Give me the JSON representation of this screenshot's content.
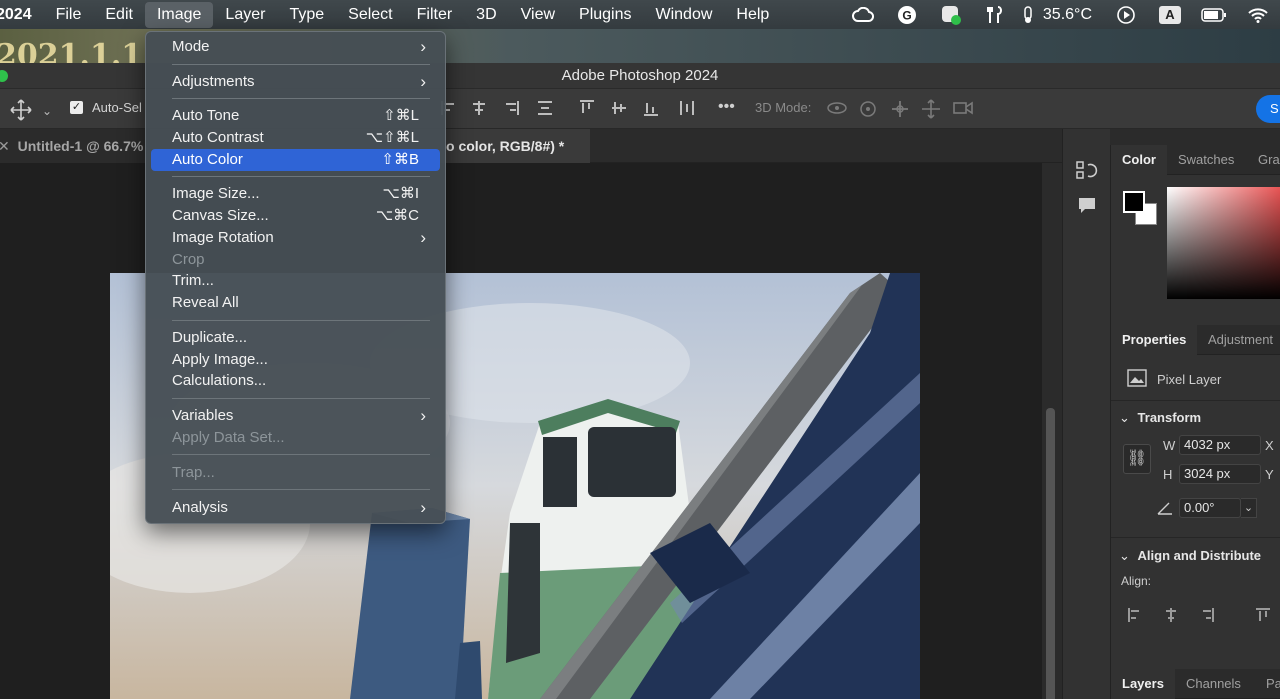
{
  "menubar": {
    "app_label": "2024",
    "items": [
      "File",
      "Edit",
      "Image",
      "Layer",
      "Type",
      "Select",
      "Filter",
      "3D",
      "View",
      "Plugins",
      "Window",
      "Help"
    ],
    "active": "Image",
    "temperature": "35.6°C",
    "input_source": "A"
  },
  "desktop": {
    "text": "2021.1.1"
  },
  "window": {
    "title": "Adobe Photoshop 2024"
  },
  "options_bar": {
    "auto_select_label": "Auto-Sel",
    "more_label": "•••",
    "mode_3d_label": "3D Mode:",
    "share_label": "S"
  },
  "tabs": [
    {
      "label": "Untitled-1 @ 66.7%"
    },
    {
      "label": "o color, RGB/8#) *"
    }
  ],
  "panels": {
    "color_tabs": [
      "Color",
      "Swatches",
      "Gra"
    ],
    "properties_tabs": [
      "Properties",
      "Adjustment"
    ],
    "pixel_layer_label": "Pixel Layer",
    "transform": {
      "heading": "Transform",
      "w_label": "W",
      "w_value": "4032 px",
      "h_label": "H",
      "h_value": "3024 px",
      "x_label": "X",
      "y_label": "Y",
      "angle_value": "0.00°"
    },
    "align": {
      "heading": "Align and Distribute",
      "label": "Align:"
    },
    "bottom_tabs": [
      "Layers",
      "Channels",
      "Pa"
    ]
  },
  "image_menu": {
    "items": [
      {
        "label": "Mode",
        "shortcut": "",
        "submenu": true,
        "disabled": false
      },
      {
        "label": "Adjustments",
        "shortcut": "",
        "submenu": true,
        "disabled": false
      },
      {
        "label": "Auto Tone",
        "shortcut": "⇧⌘L",
        "submenu": false,
        "disabled": false
      },
      {
        "label": "Auto Contrast",
        "shortcut": "⌥⇧⌘L",
        "submenu": false,
        "disabled": false
      },
      {
        "label": "Auto Color",
        "shortcut": "⇧⌘B",
        "submenu": false,
        "disabled": false,
        "highlighted": true
      },
      {
        "label": "Image Size...",
        "shortcut": "⌥⌘I",
        "submenu": false,
        "disabled": false
      },
      {
        "label": "Canvas Size...",
        "shortcut": "⌥⌘C",
        "submenu": false,
        "disabled": false
      },
      {
        "label": "Image Rotation",
        "shortcut": "",
        "submenu": true,
        "disabled": false
      },
      {
        "label": "Crop",
        "shortcut": "",
        "submenu": false,
        "disabled": true
      },
      {
        "label": "Trim...",
        "shortcut": "",
        "submenu": false,
        "disabled": false
      },
      {
        "label": "Reveal All",
        "shortcut": "",
        "submenu": false,
        "disabled": false
      },
      {
        "label": "Duplicate...",
        "shortcut": "",
        "submenu": false,
        "disabled": false
      },
      {
        "label": "Apply Image...",
        "shortcut": "",
        "submenu": false,
        "disabled": false
      },
      {
        "label": "Calculations...",
        "shortcut": "",
        "submenu": false,
        "disabled": false
      },
      {
        "label": "Variables",
        "shortcut": "",
        "submenu": true,
        "disabled": false
      },
      {
        "label": "Apply Data Set...",
        "shortcut": "",
        "submenu": false,
        "disabled": true
      },
      {
        "label": "Trap...",
        "shortcut": "",
        "submenu": false,
        "disabled": true
      },
      {
        "label": "Analysis",
        "shortcut": "",
        "submenu": true,
        "disabled": false
      }
    ]
  },
  "colors": {
    "highlight": "#2f64d6",
    "accent": "#1473e6"
  }
}
